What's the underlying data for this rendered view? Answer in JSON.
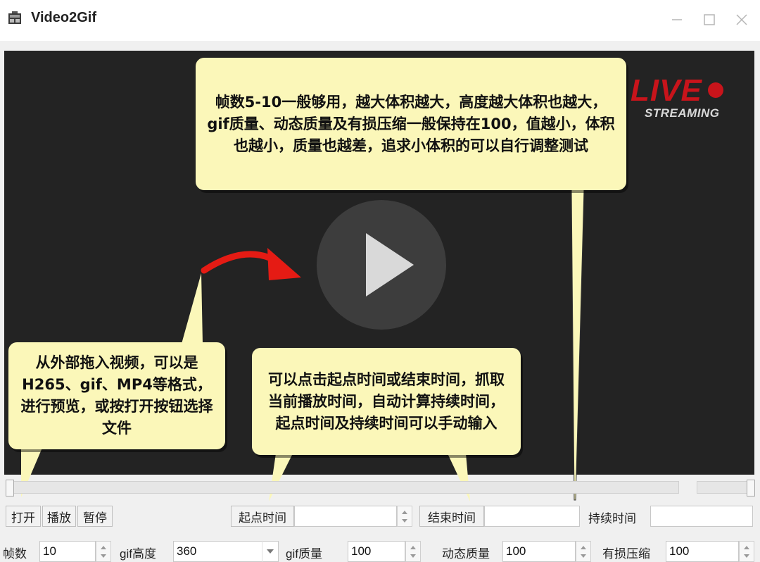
{
  "window": {
    "title": "Video2Gif"
  },
  "overlay": {
    "live_text": "LIVE",
    "streaming_text": "STREAMING"
  },
  "callouts": {
    "top": "帧数5-10一般够用，越大体积越大，高度越大体积也越大，gif质量、动态质量及有损压缩一般保持在100，值越小，体积也越小，质量也越差，追求小体积的可以自行调整测试",
    "left": "从外部拖入视频，可以是H265、gif、MP4等格式，进行预览，或按打开按钮选择文件",
    "middle": "可以点击起点时间或结束时间，抓取当前播放时间，自动计算持续时间，起点时间及持续时间可以手动输入"
  },
  "controls": {
    "open_label": "打开",
    "play_label": "播放",
    "pause_label": "暂停",
    "start_time_label": "起点时间",
    "start_time_value": "",
    "end_time_label": "结束时间",
    "end_time_value": "",
    "duration_label": "持续时间",
    "duration_value": "",
    "seek_position": 0,
    "volume_level": 1.0
  },
  "settings": {
    "fps_label": "帧数",
    "fps_value": "10",
    "gif_height_label": "gif高度",
    "gif_height_value": "360",
    "gif_quality_label": "gif质量",
    "gif_quality_value": "100",
    "motion_quality_label": "动态质量",
    "motion_quality_value": "100",
    "lossy_label": "有损压缩",
    "lossy_value": "100"
  },
  "colors": {
    "callout_bg": "#fbf7b9",
    "video_bg": "#232323",
    "live_red": "#c8141b",
    "arrow_red": "#e51b14"
  },
  "icons": [
    "app-icon",
    "minimize-icon",
    "maximize-icon",
    "close-icon",
    "play-icon",
    "curved-arrow-icon"
  ]
}
